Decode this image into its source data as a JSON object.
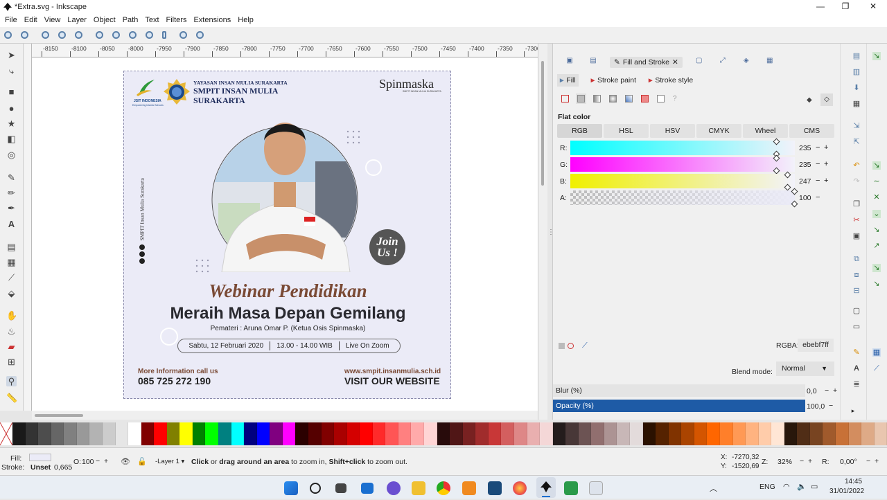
{
  "window": {
    "title": "*Extra.svg - Inkscape",
    "minimize": "—",
    "maximize": "❐",
    "close": "✕"
  },
  "menu": [
    "File",
    "Edit",
    "View",
    "Layer",
    "Object",
    "Path",
    "Text",
    "Filters",
    "Extensions",
    "Help"
  ],
  "ruler": {
    "ticks": [
      "-8150",
      "-8100",
      "-8050",
      "-8000",
      "-7950",
      "-7900",
      "-7850",
      "-7800",
      "-7750",
      "-7700",
      "-7650",
      "-7600",
      "-7550",
      "-7500",
      "-7450",
      "-7400",
      "-7350",
      "-7300"
    ]
  },
  "poster": {
    "org_line1": "YAYASAN INSAN MULIA SURAKARTA",
    "org_line2": "SMPIT INSAN MULIA",
    "org_line3": "SURAKARTA",
    "jsit": "JSIT INDONESIA",
    "jsit_tag": "Empowering Islamic Schools",
    "brand": "Spinmaska",
    "brand_sub": "SMPIT INSAN MULIA SURAKARTA",
    "side_text": "SMPIT Insan Mulia Surakarta",
    "join": "Join Us !",
    "script_title": "Webinar Pendidikan",
    "headline": "Meraih Masa Depan Gemilang",
    "speaker": "Pemateri : Aruna Omar P. (Ketua Osis Spinmaska)",
    "date": "Sabtu, 12 Februari 2020",
    "time": "13.00 - 14.00 WIB",
    "place": "Live On Zoom",
    "more_info": "More Information call us",
    "phone": "085 725 272 190",
    "url": "www.smpit.insanmulia.sch.id",
    "visit": "VISIT OUR WEBSITE"
  },
  "dock": {
    "active_tab": "Fill and Stroke",
    "sub_tabs": [
      "Fill",
      "Stroke paint",
      "Stroke style"
    ],
    "flat_color": "Flat color",
    "modes": [
      "RGB",
      "HSL",
      "HSV",
      "CMYK",
      "Wheel",
      "CMS"
    ],
    "channels": [
      {
        "label": "R:",
        "value": "235",
        "level": 0.92,
        "color": "#00ffff"
      },
      {
        "label": "G:",
        "value": "235",
        "level": 0.92,
        "color": "#ff00ff"
      },
      {
        "label": "B:",
        "value": "247",
        "level": 0.97,
        "color": "#f0f000"
      },
      {
        "label": "A:",
        "value": "100",
        "level": 1.0,
        "color": "#ebebf7"
      }
    ],
    "rgba_label": "RGBA:",
    "rgba_value": "ebebf7ff",
    "blend_label": "Blend mode:",
    "blend_value": "Normal",
    "blur_label": "Blur (%)",
    "blur_value": "0,0",
    "opacity_label": "Opacity (%)",
    "opacity_value": "100,0"
  },
  "palette": [
    "#1a1a1a",
    "#333333",
    "#4d4d4d",
    "#666666",
    "#808080",
    "#999999",
    "#b3b3b3",
    "#cccccc",
    "#e6e6e6",
    "#ffffff",
    "#800000",
    "#ff0000",
    "#808000",
    "#ffff00",
    "#008000",
    "#00ff00",
    "#008080",
    "#00ffff",
    "#000080",
    "#0000ff",
    "#800080",
    "#ff00ff",
    "#2b0000",
    "#550000",
    "#800000",
    "#aa0000",
    "#d40000",
    "#ff0000",
    "#ff2a2a",
    "#ff5555",
    "#ff8080",
    "#ffaaaa",
    "#ffd5d5",
    "#280b0b",
    "#501616",
    "#782121",
    "#a02c2c",
    "#c83737",
    "#d35f5f",
    "#de8787",
    "#e9afaf",
    "#f4d7d7",
    "#241c1c",
    "#483737",
    "#6c5353",
    "#916f6f",
    "#ac9393",
    "#c8b7b7",
    "#e3dbdb",
    "#2b1100",
    "#552200",
    "#803300",
    "#aa4400",
    "#d45500",
    "#ff6600",
    "#ff7f2a",
    "#ff9955",
    "#ffb380",
    "#ffccaa",
    "#ffe6d5",
    "#28170b",
    "#502d16",
    "#784421",
    "#a05a2c",
    "#c87137",
    "#d38d5f",
    "#deaa87",
    "#e9c6af"
  ],
  "status": {
    "fill_label": "Fill:",
    "stroke_label": "Stroke:",
    "stroke_value": "Unset",
    "stroke_width": "0,665",
    "opacity_label": "O:",
    "opacity": "100",
    "layer": "-Layer 1",
    "hint_bold1": "Click",
    "hint1": " or ",
    "hint_bold2": "drag around an area",
    "hint2": " to zoom in, ",
    "hint_bold3": "Shift+click",
    "hint3": " to zoom out.",
    "x_label": "X:",
    "x": "-7270,32",
    "y_label": "Y:",
    "y": "-1520,69",
    "zoom_label": "Z:",
    "zoom": "32%",
    "rot_label": "R:",
    "rot": "0,00°"
  },
  "taskbar": {
    "lang": "ENG",
    "time": "14:45",
    "date": "31/01/2022"
  }
}
